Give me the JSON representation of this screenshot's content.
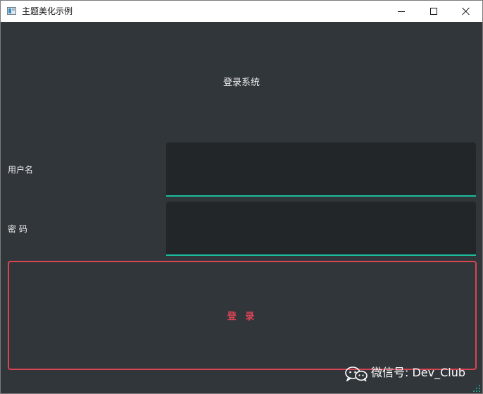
{
  "window": {
    "title": "主题美化示例"
  },
  "form": {
    "heading": "登录系统",
    "username_label": "用户名",
    "username_value": "",
    "password_label": "密 码",
    "password_value": "",
    "login_button_label": "登 录"
  },
  "watermark": {
    "text": "微信号: Dev_Club"
  },
  "colors": {
    "background": "#31363b",
    "field_background": "#232629",
    "field_underline": "#1abc9c",
    "button_accent": "#da4453",
    "text": "#eff0f1"
  },
  "icons": {
    "app": "app-window-icon",
    "minimize": "minimize-icon",
    "maximize": "maximize-icon",
    "close": "close-icon",
    "watermark": "wechat-icon",
    "grip": "size-grip-icon"
  }
}
